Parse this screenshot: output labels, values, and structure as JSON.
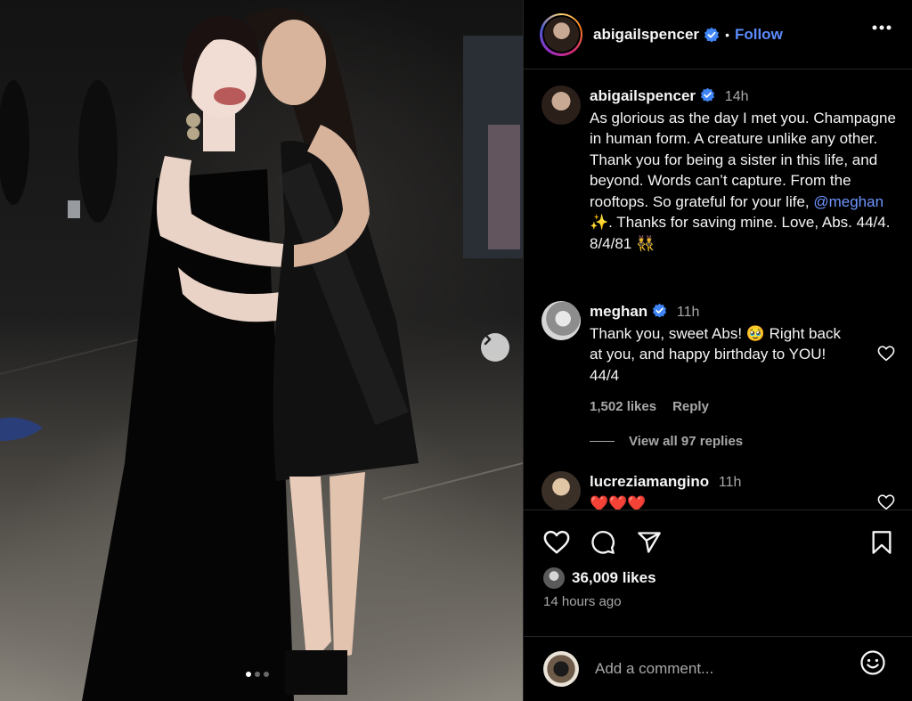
{
  "post_author": {
    "username": "abigailspencer",
    "separator": "•",
    "follow_label": "Follow"
  },
  "comments": [
    {
      "username": "abigailspencer",
      "time": "14h",
      "text_before": "As glorious as the day I met you. Champagne in human form. A creature unlike any other. Thank you for being a sister in this life, and beyond. Words can’t capture. From the rooftops. So grateful for your life, ",
      "mention": "@meghan",
      "text_after": " ✨. Thanks for saving mine. Love, Abs. 44/4. 8/4/81 👯"
    },
    {
      "username": "meghan",
      "time": "11h",
      "text": "Thank you, sweet Abs! 🥹 Right back at you, and happy birthday to YOU! 44/4",
      "likes": "1,502 likes",
      "reply_label": "Reply"
    },
    {
      "username": "lucreziamangino",
      "time": "11h",
      "text": "❤️❤️❤️"
    }
  ],
  "view_replies_label": "View all 97 replies",
  "likes_count": "36,009 likes",
  "time_ago": "14 hours ago",
  "add_comment_placeholder": "Add a comment...",
  "carousel": {
    "current_index": 1,
    "total": 3
  },
  "icons": [
    "ellipsis-icon",
    "verified-badge-icon",
    "heart-icon",
    "comment-icon",
    "share-icon",
    "bookmark-icon",
    "emoji-icon",
    "chevron-right-icon"
  ],
  "colors": {
    "background": "#000000",
    "link": "#5b8cff",
    "secondary_text": "#a8a8a8",
    "divider": "#262626"
  }
}
